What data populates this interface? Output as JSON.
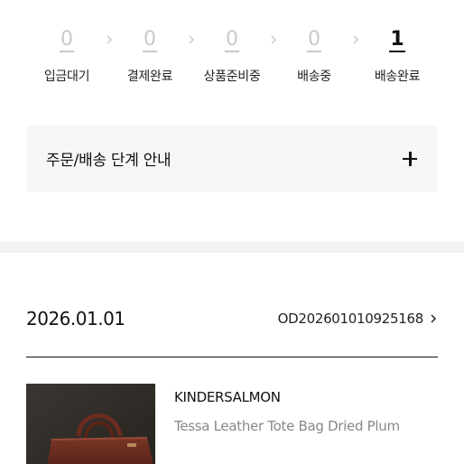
{
  "order_steps": [
    {
      "count": "0",
      "label": "입금대기",
      "active": false
    },
    {
      "count": "0",
      "label": "결제완료",
      "active": false
    },
    {
      "count": "0",
      "label": "상품준비중",
      "active": false
    },
    {
      "count": "0",
      "label": "배송중",
      "active": false
    },
    {
      "count": "1",
      "label": "배송완료",
      "active": true
    }
  ],
  "step_separator_icon": "chevron-right-icon",
  "guide": {
    "title": "주문/배송 단계 안내",
    "icon": "plus-icon"
  },
  "order": {
    "date": "2026.01.01",
    "number": "OD20260101092516​8",
    "chevron_icon": "chevron-right-icon"
  },
  "product": {
    "brand": "KINDERSALMON",
    "name": "Tessa Leather Tote Bag Dried Plum",
    "image_icon": "product-thumbnail"
  },
  "colors": {
    "text": "#111111",
    "muted": "#888888",
    "inactive": "#c9c9c9",
    "panel": "#f7f7f7",
    "band": "#f2f2f2"
  }
}
